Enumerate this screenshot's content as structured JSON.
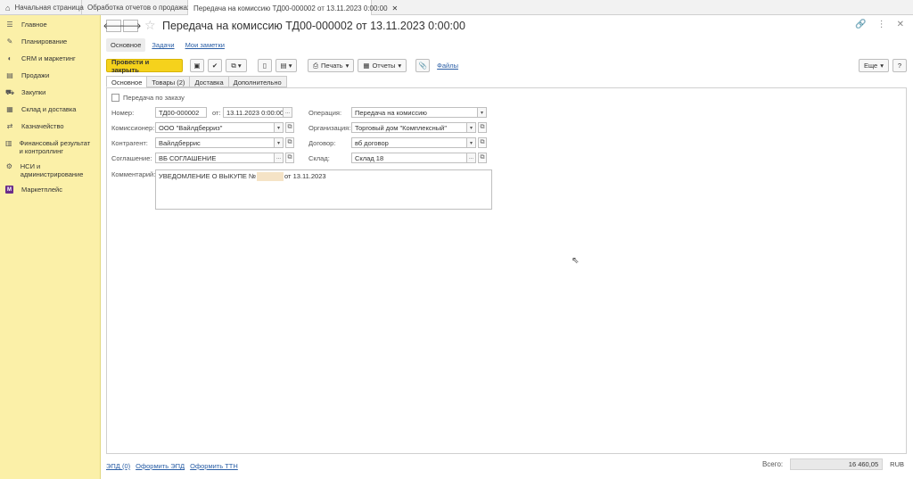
{
  "tabs": [
    {
      "label": "Начальная страница",
      "home": true,
      "closable": false,
      "active": false
    },
    {
      "label": "Обработка отчетов о продажах",
      "closable": true,
      "active": false
    },
    {
      "label": "Передача на комиссию ТД00-000002 от 13.11.2023 0:00:00",
      "closable": true,
      "active": true
    }
  ],
  "sidebar": {
    "items": [
      {
        "label": "Главное",
        "icon": "menu-icon"
      },
      {
        "label": "Планирование",
        "icon": "planning-icon"
      },
      {
        "label": "CRM и маркетинг",
        "icon": "crm-icon"
      },
      {
        "label": "Продажи",
        "icon": "sales-icon"
      },
      {
        "label": "Закупки",
        "icon": "cart-icon"
      },
      {
        "label": "Склад и доставка",
        "icon": "warehouse-icon"
      },
      {
        "label": "Казначейство",
        "icon": "treasury-icon"
      },
      {
        "label": "Финансовый результат и контроллинг",
        "icon": "finance-chart-icon"
      },
      {
        "label": "НСИ и администрирование",
        "icon": "settings-gear-icon"
      },
      {
        "label": "Маркетплейс",
        "icon": "marketplace-icon",
        "badge": "M"
      }
    ]
  },
  "document": {
    "title": "Передача на комиссию ТД00-000002 от 13.11.2023 0:00:00",
    "subtabs": [
      "Основное",
      "Задачи",
      "Мои заметки"
    ]
  },
  "toolbar": {
    "post_close": "Провести и закрыть",
    "print": "Печать",
    "reports": "Отчеты",
    "files": "Файлы",
    "more": "Еще",
    "help": "?"
  },
  "form_tabs": [
    "Основное",
    "Товары (2)",
    "Доставка",
    "Дополнительно"
  ],
  "form": {
    "by_order_label": "Передача по заказу",
    "number_label": "Номер:",
    "number_value": "ТД00-000002",
    "from_label": "от:",
    "date_value": "13.11.2023  0:00:00",
    "operation_label": "Операция:",
    "operation_value": "Передача на комиссию",
    "commissioner_label": "Комиссионер:",
    "commissioner_value": "ООО \"Вайлдберриз\"",
    "organization_label": "Организация:",
    "organization_value": "Торговый дом \"Комплексный\"",
    "counterparty_label": "Контрагент:",
    "counterparty_value": "Вайлдберрис",
    "contract_label": "Договор:",
    "contract_value": "вб договор",
    "agreement_label": "Соглашение:",
    "agreement_value": "ВБ СОГЛАШЕНИЕ",
    "warehouse_label": "Склад:",
    "warehouse_value": "Склад 18",
    "comment_label": "Комментарий:",
    "comment_prefix": "УВЕДОМЛЕНИЕ О ВЫКУПЕ №",
    "comment_suffix": "от 13.11.2023"
  },
  "footer": {
    "links": [
      "ЭПД (0)",
      "Оформить ЭПД",
      "Оформить ТТН"
    ],
    "total_label": "Всего:",
    "total_value": "16 460,05",
    "currency": "RUB"
  }
}
